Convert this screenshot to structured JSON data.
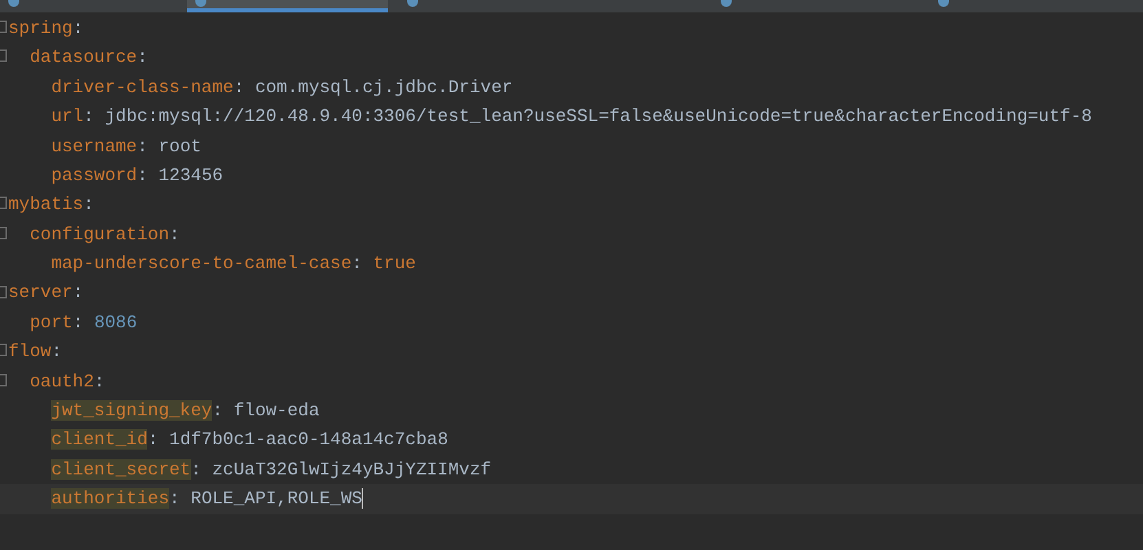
{
  "tabs": [
    {
      "selected": false
    },
    {
      "selected": true
    },
    {
      "selected": false
    },
    {
      "selected": false
    },
    {
      "selected": false
    }
  ],
  "lines": [
    {
      "key": "spring:",
      "children": [
        {
          "key": "datasource:",
          "children": [
            {
              "key": "driver-class-name:",
              "value": "com.mysql.cj.jdbc.Driver",
              "kind": "string"
            },
            {
              "key": "url:",
              "value": "jdbc:mysql://120.48.9.40:3306/test_lean?useSSL=false&useUnicode=true&characterEncoding=utf-8",
              "kind": "string"
            },
            {
              "key": "username:",
              "value": "root",
              "kind": "string"
            },
            {
              "key": "password:",
              "value": "123456",
              "kind": "string"
            }
          ]
        }
      ]
    },
    {
      "key": "mybatis:",
      "children": [
        {
          "key": "configuration:",
          "children": [
            {
              "key": "map-underscore-to-camel-case:",
              "value": "true",
              "kind": "keyword"
            }
          ]
        }
      ]
    },
    {
      "key": "server:",
      "children": [
        {
          "key": "port:",
          "value": "8086",
          "kind": "number"
        }
      ]
    },
    {
      "key": "flow:",
      "children": [
        {
          "key": "oauth2:",
          "children": [
            {
              "key": "jwt_signing_key:",
              "value": "flow-eda",
              "kind": "string",
              "highlighted": true
            },
            {
              "key": "client_id:",
              "value": "1df7b0c1-aac0-148a14c7cba8",
              "kind": "string",
              "highlighted": true
            },
            {
              "key": "client_secret:",
              "value": "zcUaT32GlwIjz4yBJjYZIIMvzf",
              "kind": "string",
              "highlighted": true
            },
            {
              "key": "authorities:",
              "value": "ROLE_API,ROLE_WS",
              "kind": "string",
              "highlighted": true,
              "current": true
            }
          ]
        }
      ]
    }
  ]
}
